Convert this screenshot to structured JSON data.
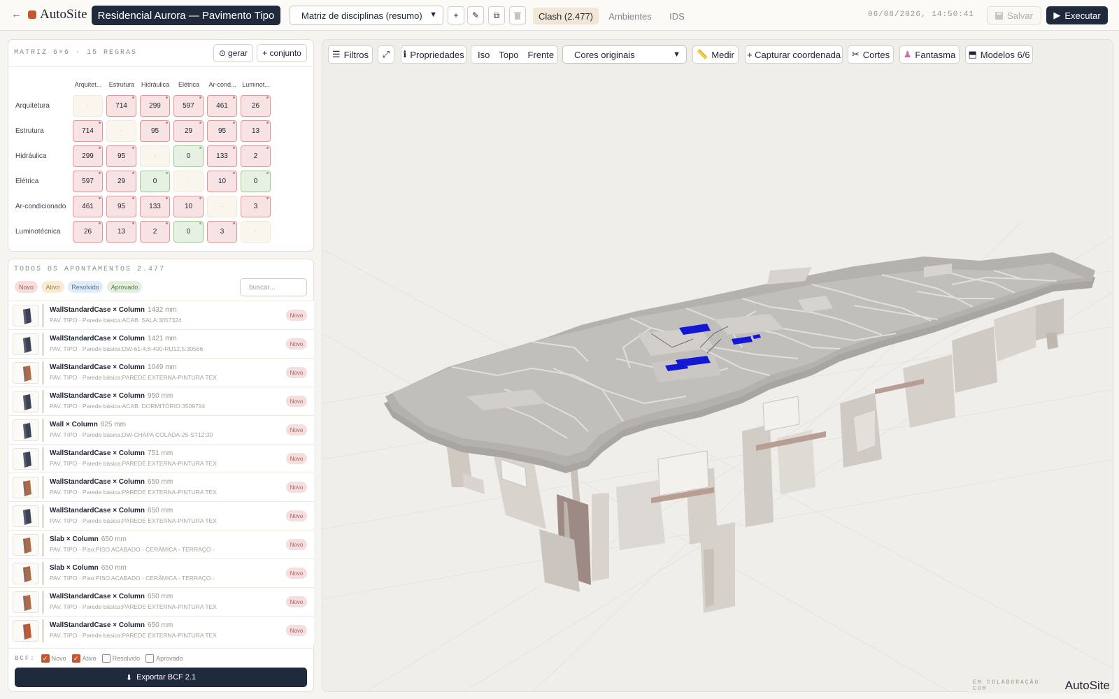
{
  "header": {
    "back_icon": "arrow-left-icon",
    "logo_text": "AutoSite",
    "project_title": "Residencial Aurora — Pavimento Tipo",
    "view_select": "Matriz de disciplinas (resumo)",
    "tools": [
      "plus-icon",
      "pencil-icon",
      "duplicate-icon",
      "trash-icon"
    ],
    "tabs": [
      {
        "label": "Clash (2.477)",
        "active": true
      },
      {
        "label": "Ambientes",
        "active": false
      },
      {
        "label": "IDS",
        "active": false
      }
    ],
    "timestamp": "06/08/2026, 14:50:41",
    "save_label": "Salvar",
    "run_label": "Executar"
  },
  "matrix": {
    "heading": "MATRIZ 6×6 · 15 REGRAS",
    "gerar_label": "gerar",
    "conjunto_label": "+ conjunto",
    "col_headers": [
      "Arquitet...",
      "Estrutura",
      "Hidráulica",
      "Elétrica",
      "Ar-cond...",
      "Luminot..."
    ],
    "row_headers": [
      "Arquitetura",
      "Estrutura",
      "Hidráulica",
      "Elétrica",
      "Ar-condicionado",
      "Luminotécnica"
    ],
    "cells": [
      [
        "-",
        "714",
        "299",
        "597",
        "461",
        "26"
      ],
      [
        "714",
        "-",
        "95",
        "29",
        "95",
        "13"
      ],
      [
        "299",
        "95",
        "-",
        "0",
        "133",
        "2"
      ],
      [
        "597",
        "29",
        "0",
        "-",
        "10",
        "0"
      ],
      [
        "461",
        "95",
        "133",
        "10",
        "-",
        "3"
      ],
      [
        "26",
        "13",
        "2",
        "0",
        "3",
        "-"
      ]
    ],
    "colors": {
      "clash": "#f7e3e3",
      "ok": "#e6f1e3",
      "diag": "#faf6ee"
    }
  },
  "issues": {
    "heading": "TODOS OS APONTAMENTOS 2.477",
    "filters": [
      "Novo",
      "Ativo",
      "Resolvido",
      "Aprovado"
    ],
    "search_placeholder": "buscar...",
    "items": [
      {
        "title": "WallStandardCase × Column",
        "length": "1432 mm",
        "sub": "PAV. TIPO · Parede básica:ACAB. SALA:3057324",
        "status": "Novo"
      },
      {
        "title": "WallStandardCase × Column",
        "length": "1421 mm",
        "sub": "PAV. TIPO · Parede básica:DW-61-4,8-400-RU12,5:30566",
        "status": "Novo"
      },
      {
        "title": "WallStandardCase × Column",
        "length": "1049 mm",
        "sub": "PAV. TIPO · Parede básica:PAREDE EXTERNA-PINTURA TEX",
        "status": "Novo"
      },
      {
        "title": "WallStandardCase × Column",
        "length": "950 mm",
        "sub": "PAV. TIPO · Parede básica:ACAB. DORMITÓRIO:3509794",
        "status": "Novo"
      },
      {
        "title": "Wall × Column",
        "length": "825 mm",
        "sub": "PAV. TIPO · Parede básica:DW-CHAPA COLADA-25-ST12:30",
        "status": "Novo"
      },
      {
        "title": "WallStandardCase × Column",
        "length": "751 mm",
        "sub": "PAV. TIPO · Parede básica:PAREDE EXTERNA-PINTURA TEX",
        "status": "Novo"
      },
      {
        "title": "WallStandardCase × Column",
        "length": "650 mm",
        "sub": "PAV. TIPO · Parede básica:PAREDE EXTERNA-PINTURA TEX",
        "status": "Novo"
      },
      {
        "title": "WallStandardCase × Column",
        "length": "650 mm",
        "sub": "PAV. TIPO · Parede básica:PAREDE EXTERNA-PINTURA TEX",
        "status": "Novo"
      },
      {
        "title": "Slab × Column",
        "length": "650 mm",
        "sub": "PAV. TIPO · Piso:PISO ACABADO - CERÂMICA - TERRAÇO -",
        "status": "Novo"
      },
      {
        "title": "Slab × Column",
        "length": "650 mm",
        "sub": "PAV. TIPO · Piso:PISO ACABADO - CERÂMICA - TERRAÇO -",
        "status": "Novo"
      },
      {
        "title": "WallStandardCase × Column",
        "length": "650 mm",
        "sub": "PAV. TIPO · Parede básica:PAREDE EXTERNA-PINTURA TEX",
        "status": "Novo"
      },
      {
        "title": "WallStandardCase × Column",
        "length": "650 mm",
        "sub": "PAV. TIPO · Parede básica:PAREDE EXTERNA-PINTURA TEX",
        "status": "Novo"
      }
    ],
    "bcf_label": "BCF:",
    "bcf_checks": [
      {
        "label": "Novo",
        "checked": true
      },
      {
        "label": "Ativo",
        "checked": true
      },
      {
        "label": "Resolvido",
        "checked": false
      },
      {
        "label": "Aprovado",
        "checked": false
      }
    ],
    "export_label": "Exportar BCF 2.1"
  },
  "viewport": {
    "filters_label": "Filtros",
    "properties_label": "Propriedades",
    "views": [
      "Iso",
      "Topo",
      "Frente"
    ],
    "color_select": "Cores originais",
    "measure_label": "Medir",
    "capture_label": "+ Capturar coordenada",
    "cuts_label": "Cortes",
    "ghost_label": "Fantasma",
    "models_label": "Modelos 6/6",
    "footer_label": "EM COLABORAÇÃO COM",
    "footer_brand": "AutoSite"
  }
}
